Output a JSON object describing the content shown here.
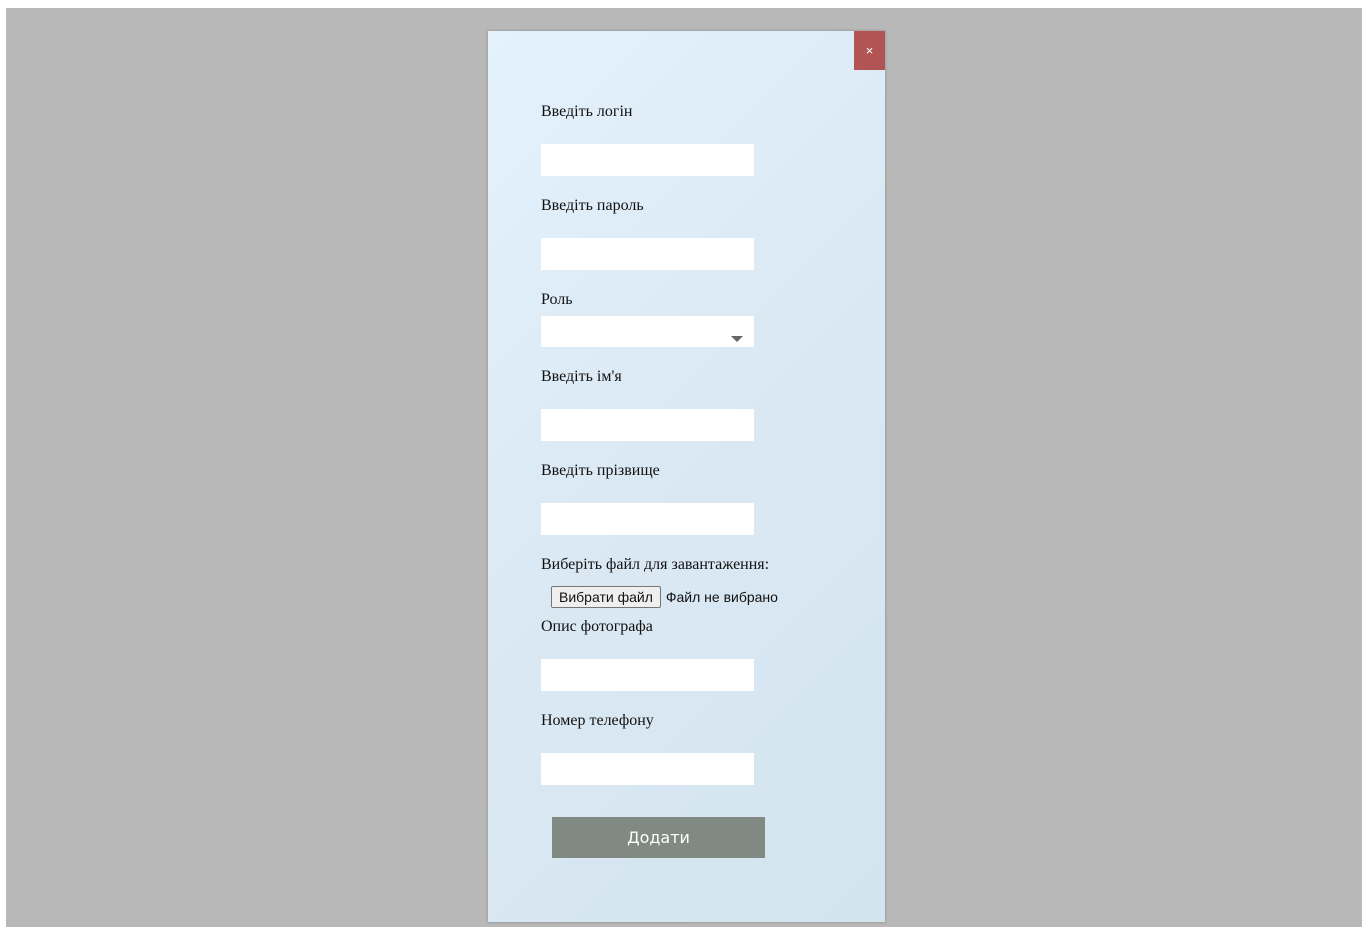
{
  "modal": {
    "close_label": "×",
    "login": {
      "label": "Введіть логін",
      "value": ""
    },
    "password": {
      "label": "Введіть пароль",
      "value": ""
    },
    "role": {
      "label": "Роль",
      "selected": ""
    },
    "first_name": {
      "label": "Введіть ім'я",
      "value": ""
    },
    "last_name": {
      "label": "Введіть прізвище",
      "value": ""
    },
    "file": {
      "label": "Виберіть файл для завантаження:",
      "button_label": "Вибрати файл",
      "status": "Файл не вибрано"
    },
    "photo_description": {
      "label": "Опис фотографа",
      "value": ""
    },
    "phone": {
      "label": "Номер телефону",
      "value": ""
    },
    "submit_label": "Додати"
  },
  "colors": {
    "overlay": "#b8b8b8",
    "close_button": "#b35454",
    "submit_button": "#808a82"
  }
}
